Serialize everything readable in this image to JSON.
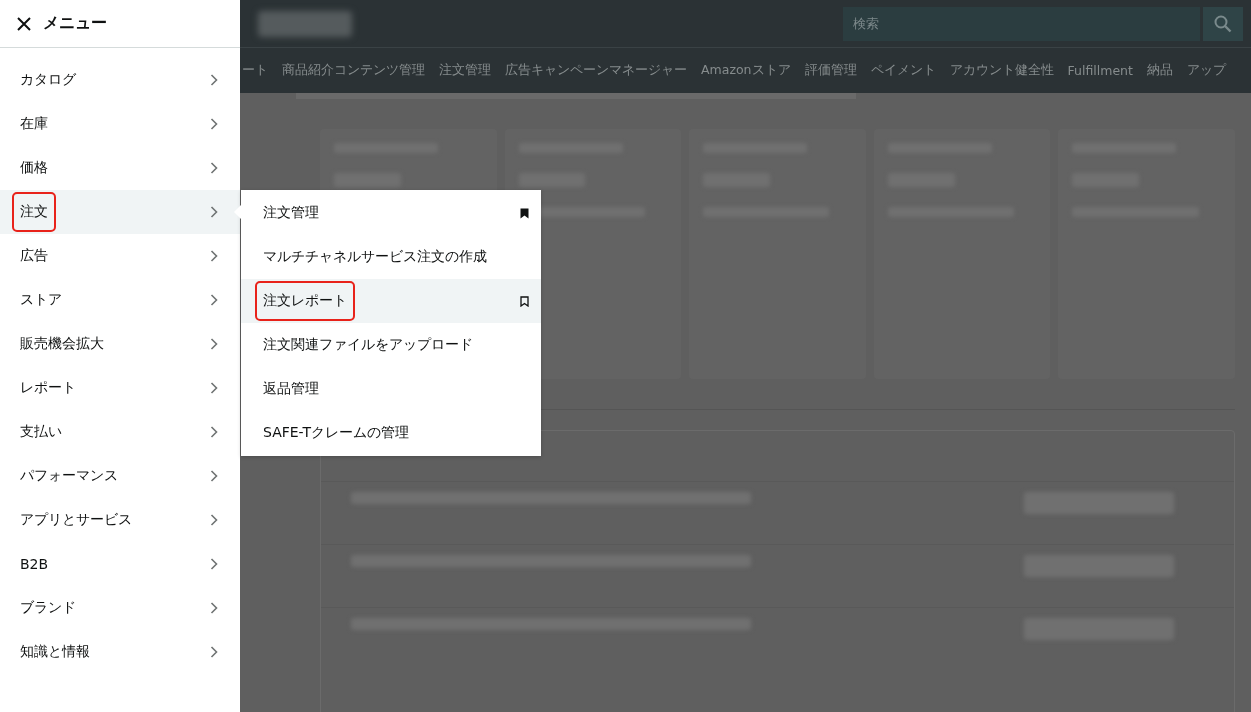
{
  "header": {
    "search": {
      "placeholder": "検索"
    }
  },
  "nav": [
    "ート",
    "商品紹介コンテンツ管理",
    "注文管理",
    "広告キャンペーンマネージャー",
    "Amazonストア",
    "評価管理",
    "ペイメント",
    "アカウント健全性",
    "Fulfillment",
    "納品",
    "アップ"
  ],
  "menu": {
    "title": "メニュー",
    "items": [
      {
        "label": "カタログ",
        "selected": false,
        "highlighted": false
      },
      {
        "label": "在庫",
        "selected": false,
        "highlighted": false
      },
      {
        "label": "価格",
        "selected": false,
        "highlighted": false
      },
      {
        "label": "注文",
        "selected": true,
        "highlighted": true
      },
      {
        "label": "広告",
        "selected": false,
        "highlighted": false
      },
      {
        "label": "ストア",
        "selected": false,
        "highlighted": false
      },
      {
        "label": "販売機会拡大",
        "selected": false,
        "highlighted": false
      },
      {
        "label": "レポート",
        "selected": false,
        "highlighted": false
      },
      {
        "label": "支払い",
        "selected": false,
        "highlighted": false
      },
      {
        "label": "パフォーマンス",
        "selected": false,
        "highlighted": false
      },
      {
        "label": "アプリとサービス",
        "selected": false,
        "highlighted": false
      },
      {
        "label": "B2B",
        "selected": false,
        "highlighted": false
      },
      {
        "label": "ブランド",
        "selected": false,
        "highlighted": false
      },
      {
        "label": "知識と情報",
        "selected": false,
        "highlighted": false
      }
    ]
  },
  "submenu": {
    "items": [
      {
        "label": "注文管理",
        "selected": false,
        "highlighted": false,
        "bookmarked": true
      },
      {
        "label": "マルチチャネルサービス注文の作成",
        "selected": false,
        "highlighted": false
      },
      {
        "label": "注文レポート",
        "selected": true,
        "highlighted": true,
        "bookmarked": false
      },
      {
        "label": "注文関連ファイルをアップロード",
        "selected": false,
        "highlighted": false
      },
      {
        "label": "返品管理",
        "selected": false,
        "highlighted": false
      },
      {
        "label": "SAFE-Tクレームの管理",
        "selected": false,
        "highlighted": false
      }
    ]
  }
}
